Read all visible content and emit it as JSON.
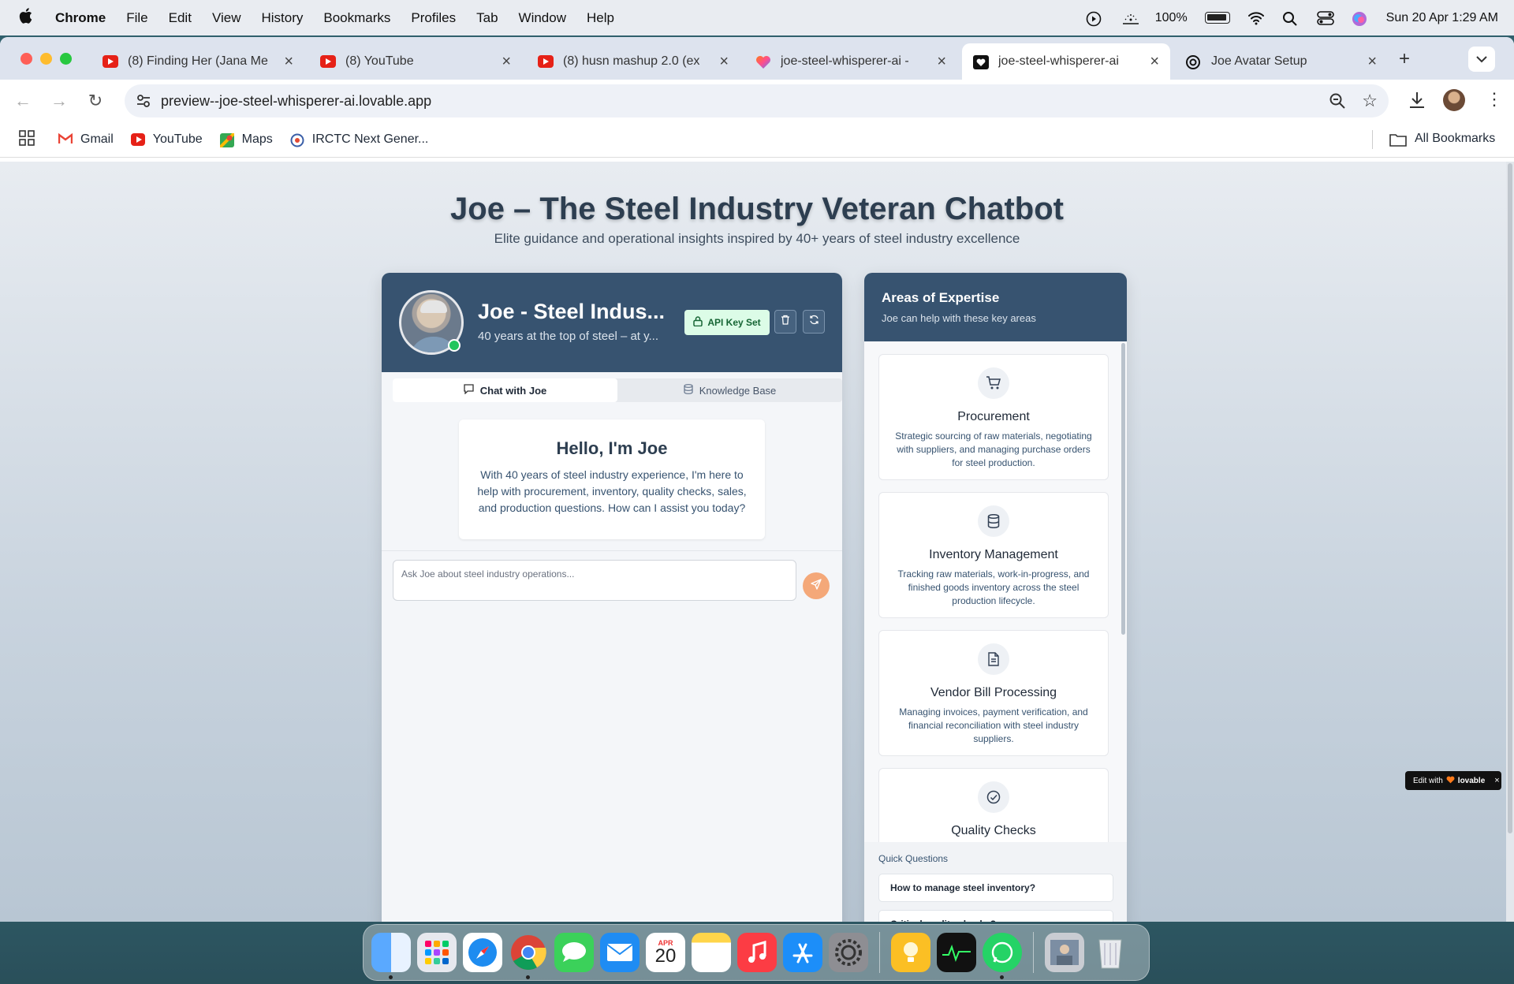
{
  "menubar": {
    "app": "Chrome",
    "items": [
      "File",
      "Edit",
      "View",
      "History",
      "Bookmarks",
      "Profiles",
      "Tab",
      "Window",
      "Help"
    ],
    "battery": "100%",
    "datetime": "Sun 20 Apr  1:29 AM"
  },
  "tabs": [
    {
      "title": "(8) Finding Her (Jana Me",
      "icon": "youtube-icon"
    },
    {
      "title": "(8) YouTube",
      "icon": "youtube-icon"
    },
    {
      "title": "(8) husn mashup 2.0 (ex",
      "icon": "youtube-icon"
    },
    {
      "title": "joe-steel-whisperer-ai -",
      "icon": "lovable-heart-icon"
    },
    {
      "title": "joe-steel-whisperer-ai",
      "icon": "heart-icon",
      "active": true
    },
    {
      "title": "Joe Avatar Setup",
      "icon": "openai-icon"
    }
  ],
  "address": {
    "url": "preview--joe-steel-whisperer-ai.lovable.app"
  },
  "bookmarks": {
    "items": [
      "Gmail",
      "YouTube",
      "Maps",
      "IRCTC Next Gener..."
    ],
    "all": "All Bookmarks"
  },
  "page": {
    "title": "Joe – The Steel Industry Veteran Chatbot",
    "subtitle": "Elite guidance and operational insights inspired by 40+ years of steel industry excellence"
  },
  "chat": {
    "name": "Joe - Steel Indus...",
    "tagline": "40 years at the top of steel – at y...",
    "api_label": "API Key Set",
    "tab_chat": "Chat with Joe",
    "tab_kb": "Knowledge Base",
    "hello_title": "Hello, I'm Joe",
    "hello_text": "With 40 years of steel industry experience, I'm here to help with procurement, inventory, quality checks, sales, and production questions. How can I assist you today?",
    "input_placeholder": "Ask Joe about steel industry operations..."
  },
  "expertise": {
    "title": "Areas of Expertise",
    "subtitle": "Joe can help with these key areas",
    "cards": [
      {
        "title": "Procurement",
        "desc": "Strategic sourcing of raw materials, negotiating with suppliers, and managing purchase orders for steel production.",
        "icon": "cart-icon"
      },
      {
        "title": "Inventory Management",
        "desc": "Tracking raw materials, work-in-progress, and finished goods inventory across the steel production lifecycle.",
        "icon": "database-icon"
      },
      {
        "title": "Vendor Bill Processing",
        "desc": "Managing invoices, payment verification, and financial reconciliation with steel industry suppliers.",
        "icon": "document-icon"
      },
      {
        "title": "Quality Checks",
        "desc": "",
        "icon": "check-circle-icon"
      }
    ],
    "quick_label": "Quick Questions",
    "quick": [
      "How to manage steel inventory?",
      "Critical quality checks?"
    ]
  },
  "badge": {
    "prefix": "Edit with",
    "brand": "lovable"
  },
  "dock": {
    "calendar_month": "APR",
    "calendar_day": "20"
  }
}
